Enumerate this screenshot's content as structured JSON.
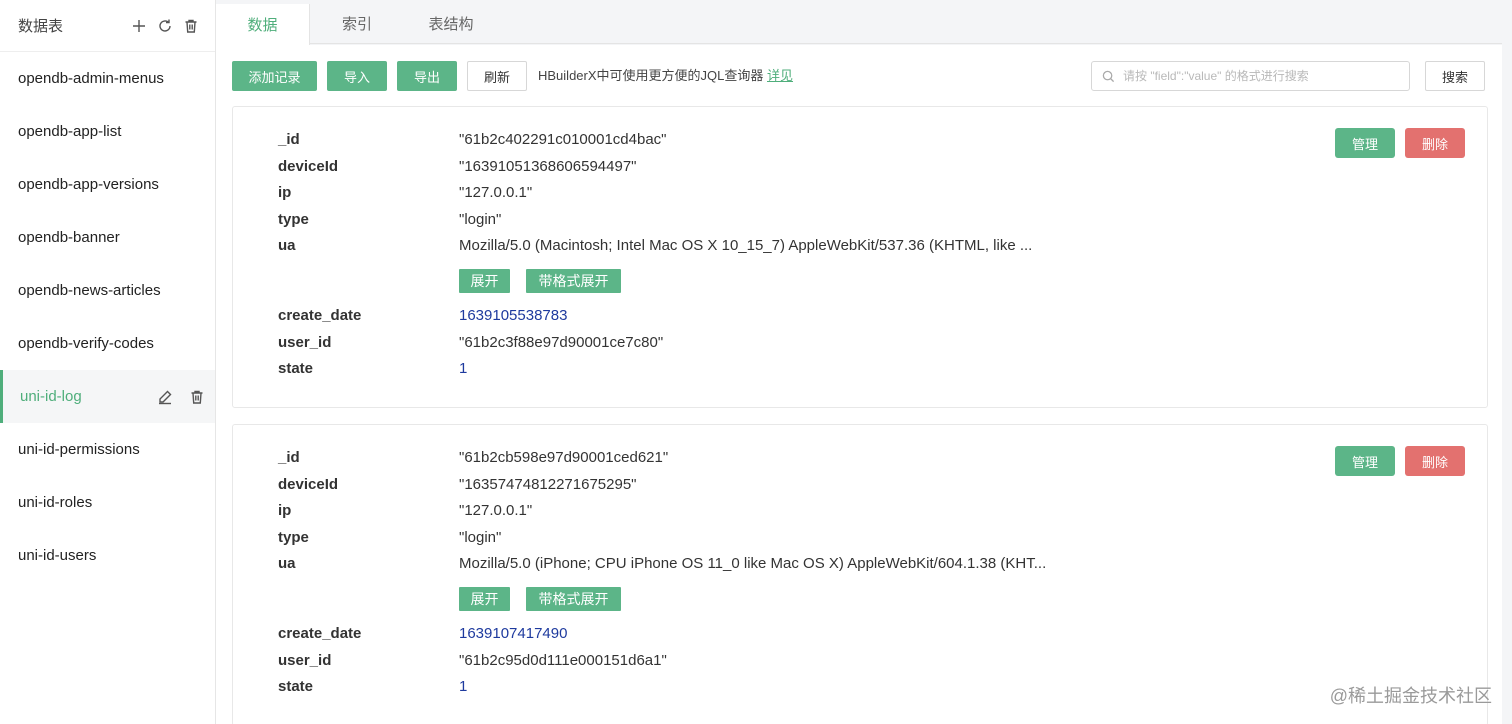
{
  "sidebar": {
    "title": "数据表",
    "tables": [
      {
        "name": "opendb-admin-menus"
      },
      {
        "name": "opendb-app-list"
      },
      {
        "name": "opendb-app-versions"
      },
      {
        "name": "opendb-banner"
      },
      {
        "name": "opendb-news-articles"
      },
      {
        "name": "opendb-verify-codes"
      },
      {
        "name": "uni-id-log",
        "active": true
      },
      {
        "name": "uni-id-permissions"
      },
      {
        "name": "uni-id-roles"
      },
      {
        "name": "uni-id-users"
      }
    ]
  },
  "tabs": [
    {
      "label": "数据",
      "active": true
    },
    {
      "label": "索引"
    },
    {
      "label": "表结构"
    }
  ],
  "toolbar": {
    "add_label": "添加记录",
    "import_label": "导入",
    "export_label": "导出",
    "refresh_label": "刷新",
    "hint": "HBuilderX中可使用更方便的JQL查询器",
    "hint_link": "详见",
    "search_placeholder": "请按 \"field\":\"value\" 的格式进行搜索",
    "search_label": "搜索"
  },
  "record_actions": {
    "manage": "管理",
    "delete": "删除",
    "expand": "展开",
    "expand_formatted": "带格式展开"
  },
  "records": [
    {
      "fields": [
        {
          "key": "_id",
          "value": "\"61b2c402291c010001cd4bac\""
        },
        {
          "key": "deviceId",
          "value": "\"16391051368606594497\""
        },
        {
          "key": "ip",
          "value": "\"127.0.0.1\""
        },
        {
          "key": "type",
          "value": "\"login\""
        },
        {
          "key": "ua",
          "value": "Mozilla/5.0 (Macintosh; Intel Mac OS X 10_15_7) AppleWebKit/537.36 (KHTML, like ..."
        },
        {
          "key": "create_date",
          "value": "1639105538783",
          "numeric": true
        },
        {
          "key": "user_id",
          "value": "\"61b2c3f88e97d90001ce7c80\""
        },
        {
          "key": "state",
          "value": "1",
          "numeric": true
        }
      ]
    },
    {
      "fields": [
        {
          "key": "_id",
          "value": "\"61b2cb598e97d90001ced621\""
        },
        {
          "key": "deviceId",
          "value": "\"16357474812271675295\""
        },
        {
          "key": "ip",
          "value": "\"127.0.0.1\""
        },
        {
          "key": "type",
          "value": "\"login\""
        },
        {
          "key": "ua",
          "value": "Mozilla/5.0 (iPhone; CPU iPhone OS 11_0 like Mac OS X) AppleWebKit/604.1.38 (KHT..."
        },
        {
          "key": "create_date",
          "value": "1639107417490",
          "numeric": true
        },
        {
          "key": "user_id",
          "value": "\"61b2c95d0d111e000151d6a1\""
        },
        {
          "key": "state",
          "value": "1",
          "numeric": true
        }
      ]
    }
  ],
  "colors": {
    "accent": "#5cb588",
    "danger": "#e3716f",
    "number": "#1e3a9e"
  },
  "watermark": "@稀土掘金技术社区"
}
